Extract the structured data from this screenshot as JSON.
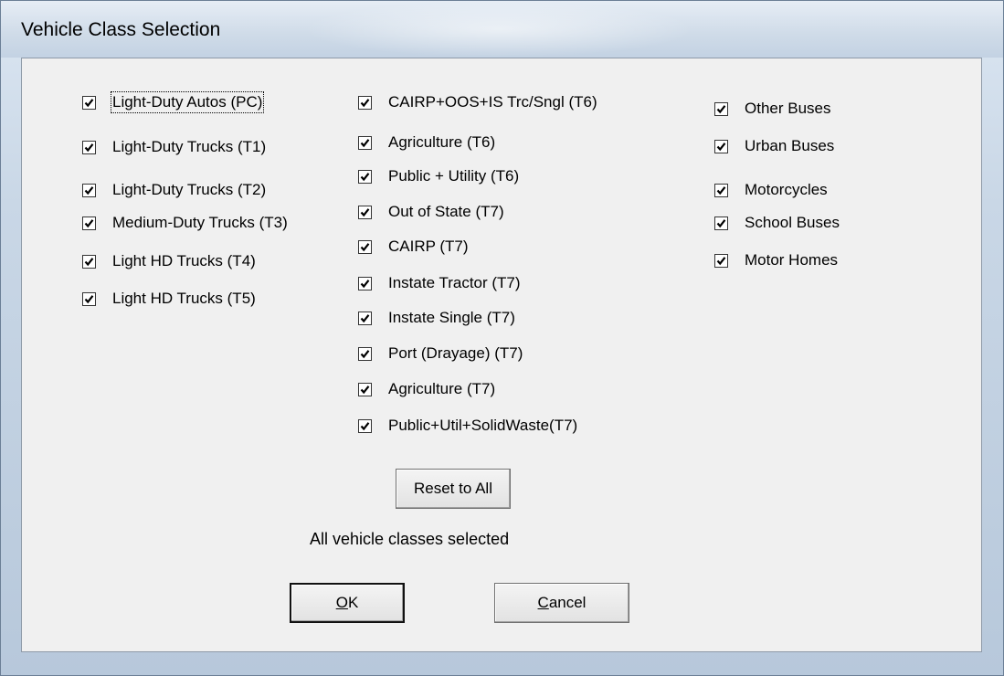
{
  "window": {
    "title": "Vehicle Class Selection"
  },
  "columns": [
    {
      "items": [
        {
          "label": "Light-Duty Autos (PC)",
          "checked": true
        },
        {
          "label": "Light-Duty Trucks (T1)",
          "checked": true
        },
        {
          "label": "Light-Duty Trucks (T2)",
          "checked": true
        },
        {
          "label": "Medium-Duty Trucks (T3)",
          "checked": true
        },
        {
          "label": "Light HD Trucks (T4)",
          "checked": true
        },
        {
          "label": "Light HD Trucks (T5)",
          "checked": true
        }
      ]
    },
    {
      "items": [
        {
          "label": "CAIRP+OOS+IS Trc/Sngl (T6)",
          "checked": true
        },
        {
          "label": "Agriculture (T6)",
          "checked": true
        },
        {
          "label": "Public + Utility (T6)",
          "checked": true
        },
        {
          "label": "Out of State (T7)",
          "checked": true
        },
        {
          "label": "CAIRP (T7)",
          "checked": true
        },
        {
          "label": "Instate Tractor (T7)",
          "checked": true
        },
        {
          "label": "Instate Single (T7)",
          "checked": true
        },
        {
          "label": "Port (Drayage) (T7)",
          "checked": true
        },
        {
          "label": "Agriculture (T7)",
          "checked": true
        },
        {
          "label": "Public+Util+SolidWaste(T7)",
          "checked": true
        }
      ]
    },
    {
      "items": [
        {
          "label": "Other Buses",
          "checked": true
        },
        {
          "label": "Urban Buses",
          "checked": true
        },
        {
          "label": "Motorcycles",
          "checked": true
        },
        {
          "label": "School Buses",
          "checked": true
        },
        {
          "label": "Motor Homes",
          "checked": true
        }
      ]
    }
  ],
  "buttons": {
    "reset": "Reset to All",
    "ok_mnemonic": "O",
    "ok_rest": "K",
    "cancel_mnemonic": "C",
    "cancel_rest": "ancel"
  },
  "status": "All vehicle classes selected"
}
